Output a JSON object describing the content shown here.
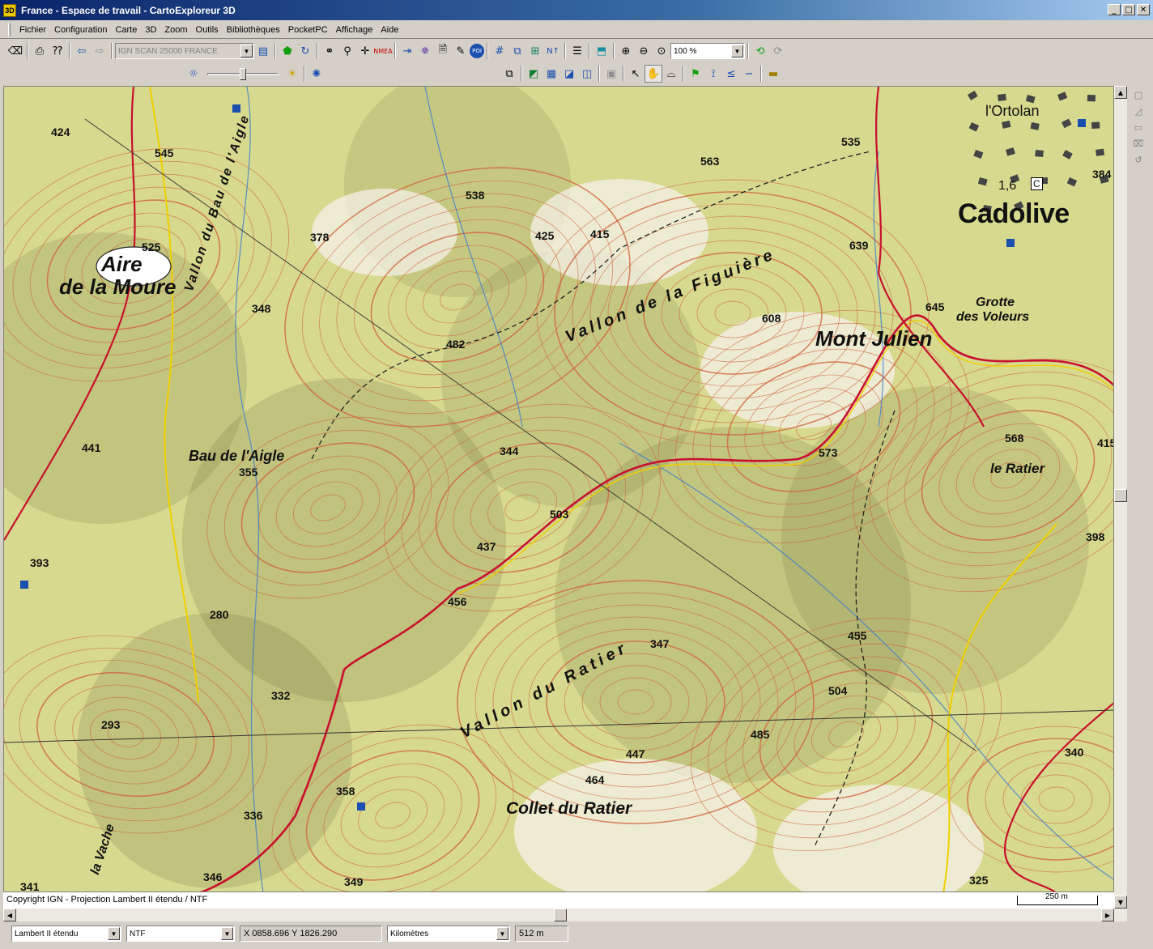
{
  "window": {
    "title": "France - Espace de travail - CartoExploreur 3D",
    "app_icon": "3D",
    "minimize_label": "_",
    "maximize_label": "□",
    "close_label": "✕"
  },
  "menu": [
    "Fichier",
    "Configuration",
    "Carte",
    "3D",
    "Zoom",
    "Outils",
    "Bibliothèques",
    "PocketPC",
    "Affichage",
    "Aide"
  ],
  "toolbar": {
    "map_layer": "IGN SCAN 25000 FRANCE",
    "zoom_value": "100 %",
    "brightness_level": 0.5
  },
  "map": {
    "places": {
      "aire": "Aire",
      "de_la_moure": "de la Moure",
      "bau_aigle": "Bau de l'Aigle",
      "vallon_bau": "Vallon du Bau de l'Aigle",
      "vallon_figuiere": "Vallon de la Figuière",
      "cadolive": "Cadolive",
      "ortolan": "l'Ortolan",
      "grotte": "Grotte",
      "des_voleurs": "des Voleurs",
      "mont_julien": "Mont Julien",
      "le_ratier": "le Ratier",
      "vallon_ratier": "Vallon du Ratier",
      "collet_ratier": "Collet du Ratier",
      "la_vache": "la Vache",
      "sign_c": "C",
      "road_16": "1,6"
    },
    "altitudes": {
      "a424": "424",
      "a545": "545",
      "a525": "525",
      "a378": "378",
      "a348": "348",
      "a538": "538",
      "a425": "425",
      "a415": "415",
      "a563": "563",
      "a535": "535",
      "a639": "639",
      "a384": "384",
      "a645": "645",
      "a608": "608",
      "a482": "482",
      "a441": "441",
      "a355": "355",
      "a344": "344",
      "a573": "573",
      "a568": "568",
      "a415b": "415",
      "a503": "503",
      "a437": "437",
      "a393": "393",
      "a398": "398",
      "a456": "456",
      "a280": "280",
      "a347": "347",
      "a455": "455",
      "a332": "332",
      "a504": "504",
      "a293": "293",
      "a485": "485",
      "a447": "447",
      "a340": "340",
      "a464": "464",
      "a358": "358",
      "a336": "336",
      "a346": "346",
      "a349": "349",
      "a341": "341",
      "a325": "325"
    }
  },
  "copyright": "Copyright IGN - Projection Lambert II étendu / NTF",
  "scale_label": "250 m",
  "status": {
    "projection": "Lambert II étendu",
    "datum": "NTF",
    "coords": "X 0858.696  Y 1826.290",
    "units": "Kilomètres",
    "distance": "512 m"
  },
  "colors": {
    "terrain": "#d6d98e",
    "contour": "#d0603a",
    "road_red": "#c8102e",
    "road_yellow": "#f0d000",
    "water": "#3a7ad0",
    "titlebar": "#0a246a"
  }
}
